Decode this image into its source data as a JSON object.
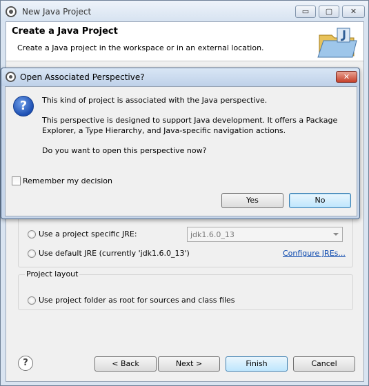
{
  "main_window": {
    "title": "New Java Project",
    "controls": {
      "minimize": "▭",
      "maximize": "▢",
      "close": "✕"
    },
    "header": {
      "title": "Create a Java Project",
      "description": "Create a Java project in the workspace or in an external location."
    },
    "jre_group": {
      "option_specific": "Use a project specific JRE:",
      "option_default": "Use default JRE (currently 'jdk1.6.0_13')",
      "jre_select_value": "jdk1.6.0_13",
      "configure_link": "Configure JREs..."
    },
    "layout_group": {
      "label": "Project layout",
      "option_root": "Use project folder as root for sources and class files"
    },
    "buttons": {
      "back": "< Back",
      "next": "Next >",
      "finish": "Finish",
      "cancel": "Cancel"
    },
    "help_icon_glyph": "?"
  },
  "dialog": {
    "title": "Open Associated Perspective?",
    "close_glyph": "✕",
    "question_glyph": "?",
    "message_1": "This kind of project is associated with the Java perspective.",
    "message_2": "This perspective is designed to support Java development. It offers a Package Explorer, a Type Hierarchy, and Java-specific navigation actions.",
    "message_3": "Do you want to open this perspective now?",
    "remember_label": "Remember my decision",
    "yes_label": "Yes",
    "no_label": "No"
  },
  "icons": {
    "window_icon": "eclipse-icon",
    "header_icon": "java-folder-icon",
    "dialog_icon": "eclipse-icon",
    "question_icon": "question-icon",
    "help_icon": "help-icon"
  },
  "colors": {
    "window_frame": "#d9e4f1",
    "dialog_frame": "#c7d6ea",
    "default_button": "#bee6fd",
    "close_button": "#c7412a",
    "link": "#0645ad"
  }
}
